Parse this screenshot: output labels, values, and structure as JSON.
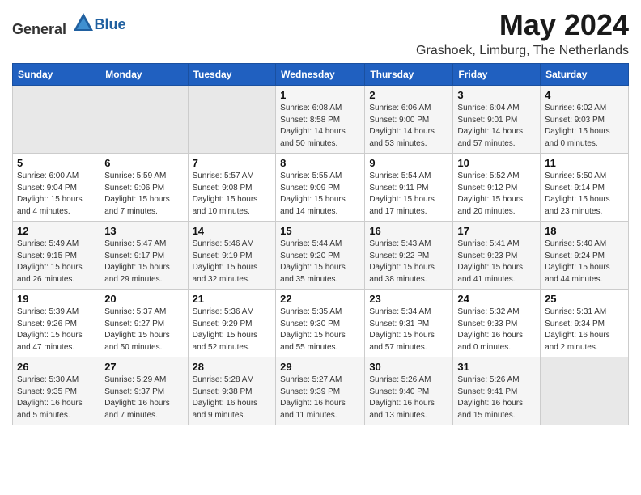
{
  "header": {
    "logo_general": "General",
    "logo_blue": "Blue",
    "title": "May 2024",
    "subtitle": "Grashoek, Limburg, The Netherlands"
  },
  "calendar": {
    "days_of_week": [
      "Sunday",
      "Monday",
      "Tuesday",
      "Wednesday",
      "Thursday",
      "Friday",
      "Saturday"
    ],
    "weeks": [
      [
        {
          "day": "",
          "info": ""
        },
        {
          "day": "",
          "info": ""
        },
        {
          "day": "",
          "info": ""
        },
        {
          "day": "1",
          "info": "Sunrise: 6:08 AM\nSunset: 8:58 PM\nDaylight: 14 hours\nand 50 minutes."
        },
        {
          "day": "2",
          "info": "Sunrise: 6:06 AM\nSunset: 9:00 PM\nDaylight: 14 hours\nand 53 minutes."
        },
        {
          "day": "3",
          "info": "Sunrise: 6:04 AM\nSunset: 9:01 PM\nDaylight: 14 hours\nand 57 minutes."
        },
        {
          "day": "4",
          "info": "Sunrise: 6:02 AM\nSunset: 9:03 PM\nDaylight: 15 hours\nand 0 minutes."
        }
      ],
      [
        {
          "day": "5",
          "info": "Sunrise: 6:00 AM\nSunset: 9:04 PM\nDaylight: 15 hours\nand 4 minutes."
        },
        {
          "day": "6",
          "info": "Sunrise: 5:59 AM\nSunset: 9:06 PM\nDaylight: 15 hours\nand 7 minutes."
        },
        {
          "day": "7",
          "info": "Sunrise: 5:57 AM\nSunset: 9:08 PM\nDaylight: 15 hours\nand 10 minutes."
        },
        {
          "day": "8",
          "info": "Sunrise: 5:55 AM\nSunset: 9:09 PM\nDaylight: 15 hours\nand 14 minutes."
        },
        {
          "day": "9",
          "info": "Sunrise: 5:54 AM\nSunset: 9:11 PM\nDaylight: 15 hours\nand 17 minutes."
        },
        {
          "day": "10",
          "info": "Sunrise: 5:52 AM\nSunset: 9:12 PM\nDaylight: 15 hours\nand 20 minutes."
        },
        {
          "day": "11",
          "info": "Sunrise: 5:50 AM\nSunset: 9:14 PM\nDaylight: 15 hours\nand 23 minutes."
        }
      ],
      [
        {
          "day": "12",
          "info": "Sunrise: 5:49 AM\nSunset: 9:15 PM\nDaylight: 15 hours\nand 26 minutes."
        },
        {
          "day": "13",
          "info": "Sunrise: 5:47 AM\nSunset: 9:17 PM\nDaylight: 15 hours\nand 29 minutes."
        },
        {
          "day": "14",
          "info": "Sunrise: 5:46 AM\nSunset: 9:19 PM\nDaylight: 15 hours\nand 32 minutes."
        },
        {
          "day": "15",
          "info": "Sunrise: 5:44 AM\nSunset: 9:20 PM\nDaylight: 15 hours\nand 35 minutes."
        },
        {
          "day": "16",
          "info": "Sunrise: 5:43 AM\nSunset: 9:22 PM\nDaylight: 15 hours\nand 38 minutes."
        },
        {
          "day": "17",
          "info": "Sunrise: 5:41 AM\nSunset: 9:23 PM\nDaylight: 15 hours\nand 41 minutes."
        },
        {
          "day": "18",
          "info": "Sunrise: 5:40 AM\nSunset: 9:24 PM\nDaylight: 15 hours\nand 44 minutes."
        }
      ],
      [
        {
          "day": "19",
          "info": "Sunrise: 5:39 AM\nSunset: 9:26 PM\nDaylight: 15 hours\nand 47 minutes."
        },
        {
          "day": "20",
          "info": "Sunrise: 5:37 AM\nSunset: 9:27 PM\nDaylight: 15 hours\nand 50 minutes."
        },
        {
          "day": "21",
          "info": "Sunrise: 5:36 AM\nSunset: 9:29 PM\nDaylight: 15 hours\nand 52 minutes."
        },
        {
          "day": "22",
          "info": "Sunrise: 5:35 AM\nSunset: 9:30 PM\nDaylight: 15 hours\nand 55 minutes."
        },
        {
          "day": "23",
          "info": "Sunrise: 5:34 AM\nSunset: 9:31 PM\nDaylight: 15 hours\nand 57 minutes."
        },
        {
          "day": "24",
          "info": "Sunrise: 5:32 AM\nSunset: 9:33 PM\nDaylight: 16 hours\nand 0 minutes."
        },
        {
          "day": "25",
          "info": "Sunrise: 5:31 AM\nSunset: 9:34 PM\nDaylight: 16 hours\nand 2 minutes."
        }
      ],
      [
        {
          "day": "26",
          "info": "Sunrise: 5:30 AM\nSunset: 9:35 PM\nDaylight: 16 hours\nand 5 minutes."
        },
        {
          "day": "27",
          "info": "Sunrise: 5:29 AM\nSunset: 9:37 PM\nDaylight: 16 hours\nand 7 minutes."
        },
        {
          "day": "28",
          "info": "Sunrise: 5:28 AM\nSunset: 9:38 PM\nDaylight: 16 hours\nand 9 minutes."
        },
        {
          "day": "29",
          "info": "Sunrise: 5:27 AM\nSunset: 9:39 PM\nDaylight: 16 hours\nand 11 minutes."
        },
        {
          "day": "30",
          "info": "Sunrise: 5:26 AM\nSunset: 9:40 PM\nDaylight: 16 hours\nand 13 minutes."
        },
        {
          "day": "31",
          "info": "Sunrise: 5:26 AM\nSunset: 9:41 PM\nDaylight: 16 hours\nand 15 minutes."
        },
        {
          "day": "",
          "info": ""
        }
      ]
    ]
  }
}
